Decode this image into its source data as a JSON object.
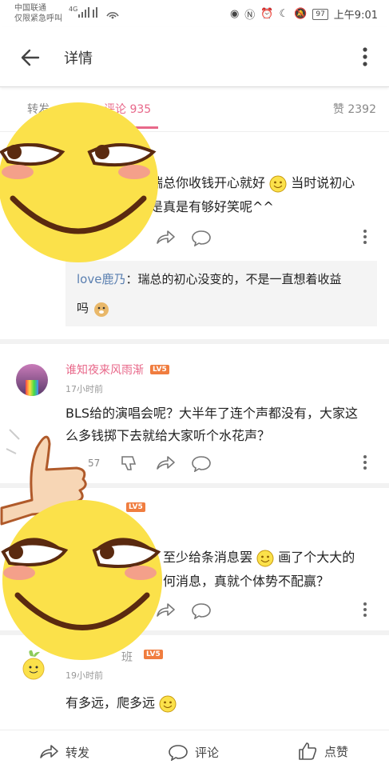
{
  "status_bar": {
    "carrier_line1": "中国联通",
    "carrier_line2": "仅限紧急呼叫",
    "signal": "4G",
    "battery": "97",
    "time": "上午9:01"
  },
  "app_bar": {
    "title": "详情"
  },
  "tabs": {
    "repost_label": "转发",
    "comment_label": "评论 935",
    "like_label": "赞 2392"
  },
  "comments": [
    {
      "text_line1": "瑞总你收钱开心就好",
      "text_line1b": "当时说初心",
      "text_line2": "是真是有够好笑呢^^",
      "reply_user": "love鹿乃",
      "reply_text_line1": "：瑞总的初心没变的，不是一直想着收益",
      "reply_text_line2": "吗"
    },
    {
      "username": "谁知夜来风雨渐",
      "level": "LV5",
      "time": "17小时前",
      "text_line1": "BLS给的演唱会呢？大半年了连个声都没有，大家这",
      "text_line2": "么多钱掷下去就给大家听个水花声？",
      "like_count": "57"
    },
    {
      "level": "LV5",
      "text_line1a": "至少给条消息罢",
      "text_line1b": "画了个大大的",
      "text_line2": "何消息，真就个体势不配赢？"
    },
    {
      "username_fragment": "班",
      "level": "LV5",
      "time": "19小时前",
      "text": "有多远，爬多远"
    }
  ],
  "bottom_bar": {
    "repost": "转发",
    "comment": "评论",
    "like": "点赞"
  },
  "colors": {
    "accent": "#e8688a",
    "level_badge": "#f07d3f",
    "emoji_yellow": "#fbe14a"
  }
}
